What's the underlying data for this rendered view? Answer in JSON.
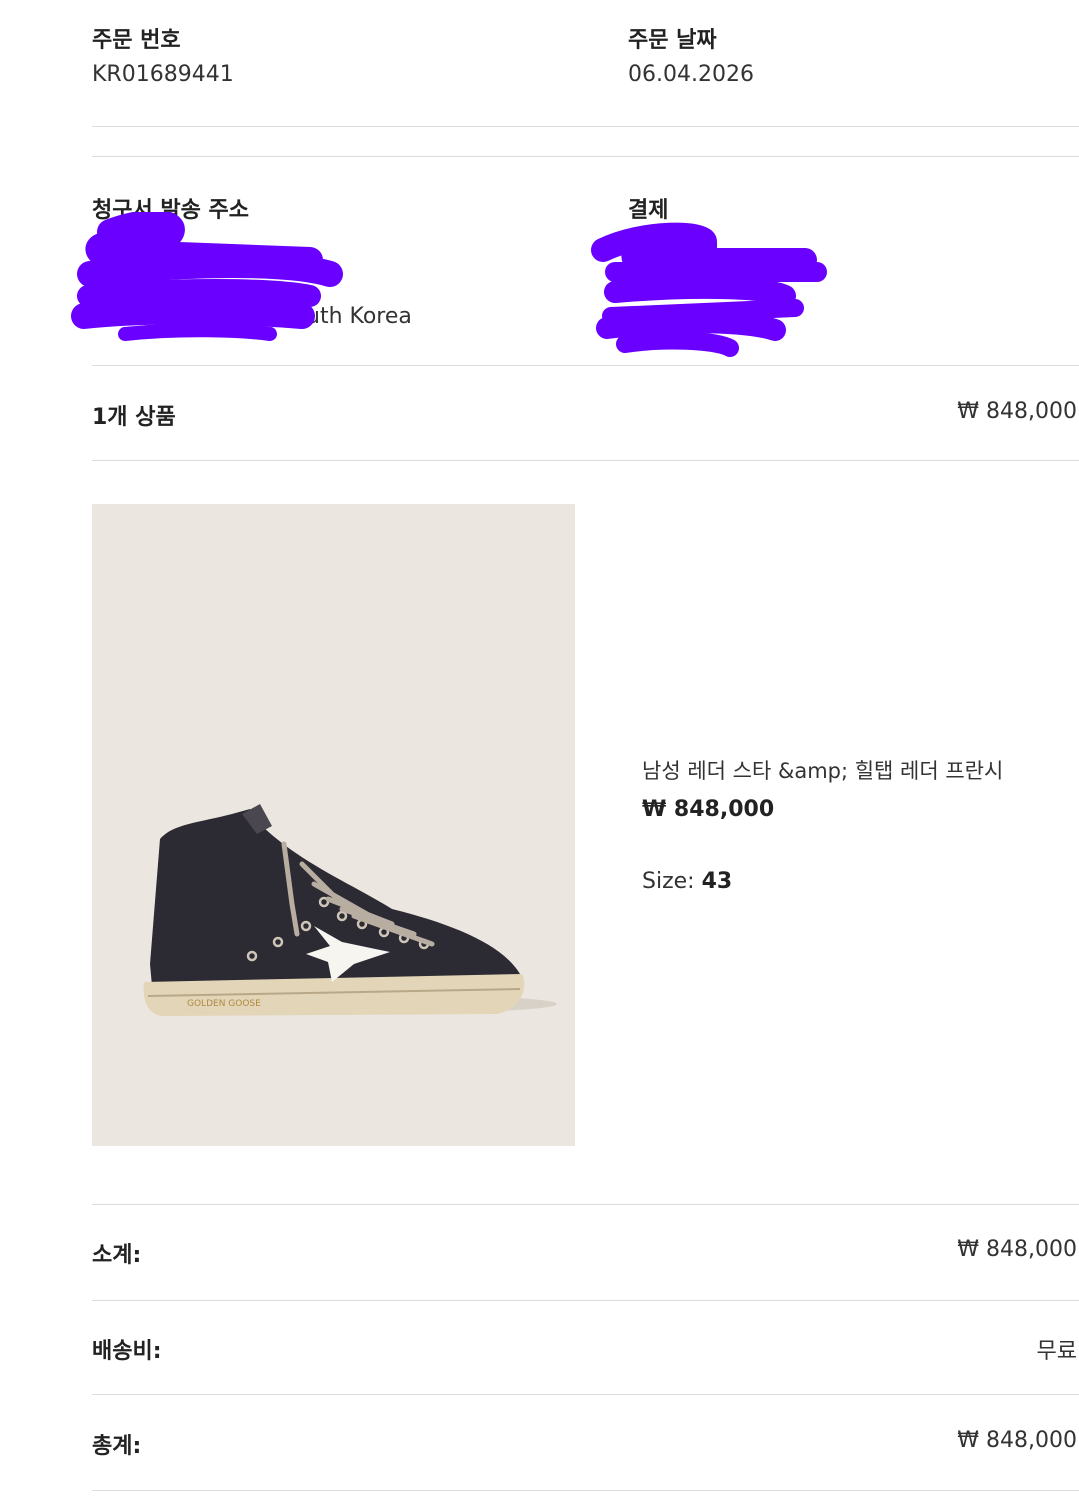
{
  "order": {
    "number_label": "주문 번호",
    "number_value": "KR01689441",
    "date_label": "주문 날짜",
    "date_value": "06.04.2026"
  },
  "billing": {
    "label": "청구서 발송 주소",
    "visible_fragment": "uth Korea"
  },
  "payment": {
    "label": "결제"
  },
  "items": {
    "count_label": "1개 상품",
    "total": "₩ 848,000"
  },
  "product": {
    "name": "남성 레더 스타 &amp; 힐탭 레더 프란시",
    "price": "₩ 848,000",
    "size_label": "Size:",
    "size_value": "43",
    "brand_print": "GOLDEN GOOSE"
  },
  "summary": {
    "subtotal_label": "소계:",
    "subtotal_value": "₩ 848,000",
    "shipping_label": "배송비:",
    "shipping_value": "무료",
    "total_label": "총계:",
    "total_value": "₩ 848,000"
  },
  "colors": {
    "redaction": "#6a00ff",
    "divider": "#dcdcdc"
  }
}
